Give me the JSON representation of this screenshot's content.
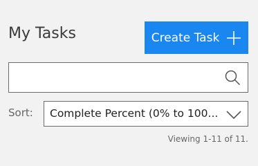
{
  "header": {
    "title": "My Tasks",
    "create_button_label": "Create Task",
    "create_button_icon": "plus-icon",
    "accent_color": "#1a86f0"
  },
  "search": {
    "value": "",
    "placeholder": "",
    "icon": "search-icon"
  },
  "sort": {
    "label": "Sort:",
    "selected": "Complete Percent (0% to 100...",
    "icon": "chevron-down-icon"
  },
  "footer": {
    "viewing": "Viewing 1-11 of 11."
  }
}
